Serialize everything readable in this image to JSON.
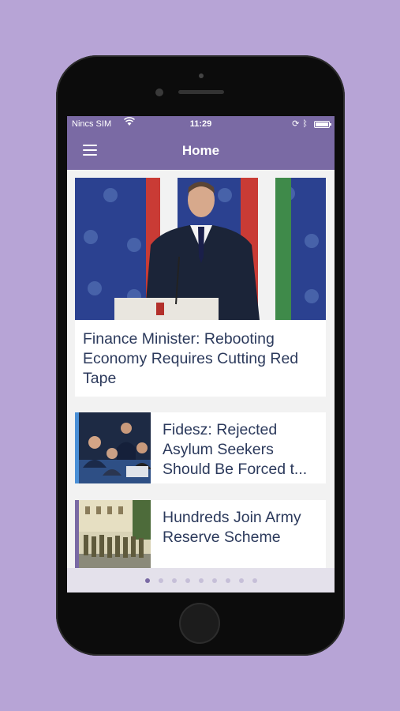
{
  "status_bar": {
    "carrier": "Nincs SIM",
    "time": "11:29"
  },
  "nav": {
    "title": "Home",
    "menu_icon": "hamburger-menu-icon"
  },
  "articles": [
    {
      "title": "Finance Minister: Rebooting Economy Requires Cutting Red Tape"
    },
    {
      "title": "Fidesz: Rejected Asylum Seekers Should Be Forced t...",
      "accent": "#4a8fd6"
    },
    {
      "title": "Hundreds Join Army Reserve Scheme",
      "accent": "#7a6aa4"
    }
  ],
  "pager": {
    "total": 9,
    "active": 0
  },
  "colors": {
    "background": "#b7a4d6",
    "brand": "#7a6aa4",
    "headline_text": "#2c3a5c"
  }
}
